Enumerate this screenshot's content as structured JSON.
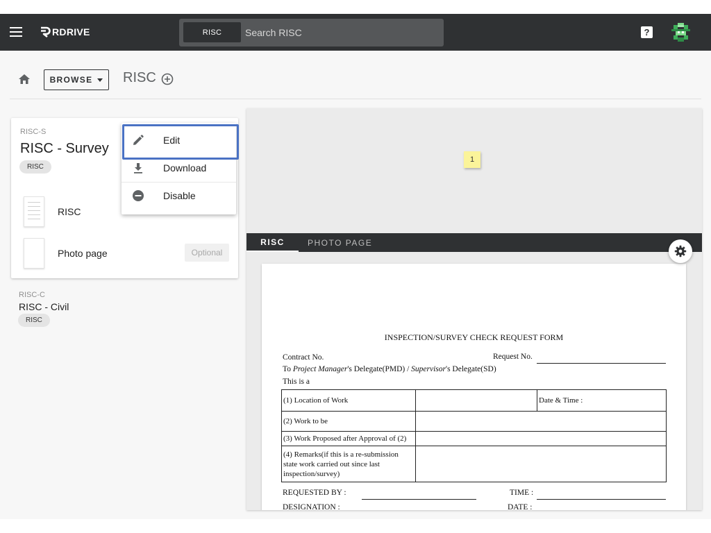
{
  "topbar": {
    "menu_icon": "menu-icon",
    "logo_text": "RDRIVE",
    "search": {
      "chip_label": "RISC",
      "placeholder": "Search RISC"
    },
    "help_icon": "help-icon",
    "help_glyph": "?",
    "avatar_icon": "pixel-avatar"
  },
  "breadcrumb": {
    "home_icon": "home-icon",
    "browse_label": "BROWSE",
    "title": "RISC",
    "add_icon": "add-circle-icon"
  },
  "sidebar": {
    "card": {
      "code": "RISC-S",
      "title": "RISC - Survey",
      "tag": "RISC",
      "files": [
        {
          "name": "RISC",
          "optional": ""
        },
        {
          "name": "Photo page",
          "optional": "Optional"
        }
      ]
    },
    "item2": {
      "code": "RISC-C",
      "title": "RISC - Civil",
      "tag": "RISC"
    }
  },
  "context_menu": {
    "items": [
      {
        "label": "Edit",
        "icon": "edit-icon"
      },
      {
        "label": "Download",
        "icon": "download-icon"
      },
      {
        "label": "Disable",
        "icon": "disable-icon"
      }
    ],
    "highlighted": "Edit",
    "highlight_color": "#4a72c4"
  },
  "viewer": {
    "sticky_note": "1",
    "tabs": [
      {
        "label": "RISC",
        "active": true
      },
      {
        "label": "PHOTO PAGE",
        "active": false
      }
    ],
    "settings_icon": "gear-icon",
    "document": {
      "title": "INSPECTION/SURVEY CHECK REQUEST FORM",
      "contract_label": "Contract No.",
      "request_label": "Request No.",
      "to_prefix": "To",
      "to_pm": "Project Manager",
      "to_mid": "'s Delegate(PMD) / ",
      "to_sup": "Supervisor",
      "to_end": "'s Delegate(SD)",
      "this_is_a": "This is a",
      "rows": [
        {
          "label": "(1) Location of Work",
          "extra": "Date & Time :"
        },
        {
          "label": "(2) Work to be",
          "extra": ""
        },
        {
          "label": "(3) Work Proposed after Approval of (2)",
          "extra": ""
        },
        {
          "label": "(4) Remarks(if this is a re-submission state work carried out since last inspection/survey)",
          "extra": ""
        }
      ],
      "requested_by": "REQUESTED BY :",
      "time": "TIME :",
      "designation": "DESIGNATION :",
      "date": "DATE :"
    }
  },
  "colors": {
    "topbar": "#2f3133",
    "search": "#555759",
    "accent_highlight": "#4a72c4",
    "sticky": "#fbf49a"
  }
}
